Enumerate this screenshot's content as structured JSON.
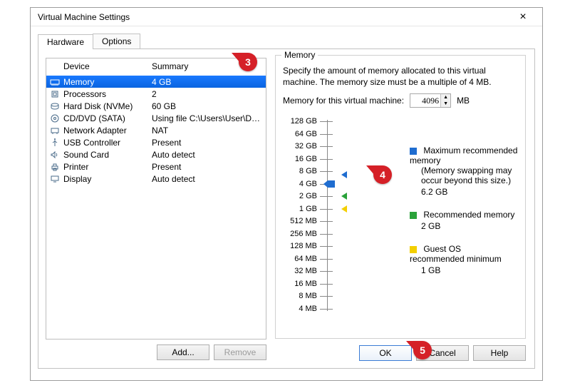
{
  "window": {
    "title": "Virtual Machine Settings"
  },
  "tabs": {
    "hardware": "Hardware",
    "options": "Options",
    "active": "hardware"
  },
  "device_list": {
    "headers": {
      "device": "Device",
      "summary": "Summary"
    },
    "rows": [
      {
        "id": "memory",
        "name": "Memory",
        "summary": "4 GB",
        "selected": true
      },
      {
        "id": "cpu",
        "name": "Processors",
        "summary": "2",
        "selected": false
      },
      {
        "id": "hdd",
        "name": "Hard Disk (NVMe)",
        "summary": "60 GB",
        "selected": false
      },
      {
        "id": "cddvd",
        "name": "CD/DVD (SATA)",
        "summary": "Using file C:\\Users\\User\\Do...",
        "selected": false
      },
      {
        "id": "net",
        "name": "Network Adapter",
        "summary": "NAT",
        "selected": false
      },
      {
        "id": "usb",
        "name": "USB Controller",
        "summary": "Present",
        "selected": false
      },
      {
        "id": "sound",
        "name": "Sound Card",
        "summary": "Auto detect",
        "selected": false
      },
      {
        "id": "printer",
        "name": "Printer",
        "summary": "Present",
        "selected": false
      },
      {
        "id": "display",
        "name": "Display",
        "summary": "Auto detect",
        "selected": false
      }
    ],
    "buttons": {
      "add": "Add...",
      "remove": "Remove"
    }
  },
  "memory_panel": {
    "group_title": "Memory",
    "description": "Specify the amount of memory allocated to this virtual machine. The memory size must be a multiple of 4 MB.",
    "field_label": "Memory for this virtual machine:",
    "value_mb": "4096",
    "unit": "MB",
    "scale": [
      {
        "label": "128 GB",
        "major": true
      },
      {
        "label": "64 GB",
        "major": true
      },
      {
        "label": "32 GB",
        "major": true
      },
      {
        "label": "16 GB",
        "major": true
      },
      {
        "label": "8 GB",
        "major": true
      },
      {
        "label": "4 GB",
        "major": true
      },
      {
        "label": "2 GB",
        "major": true
      },
      {
        "label": "1 GB",
        "major": true
      },
      {
        "label": "512 MB",
        "major": true
      },
      {
        "label": "256 MB",
        "major": true
      },
      {
        "label": "128 MB",
        "major": true
      },
      {
        "label": "64 MB",
        "major": true
      },
      {
        "label": "32 MB",
        "major": true
      },
      {
        "label": "16 MB",
        "major": true
      },
      {
        "label": "8 MB",
        "major": true
      },
      {
        "label": "4 MB",
        "major": true
      }
    ],
    "markers": {
      "slider_at_index": 5,
      "max_recommended_index": 4.3,
      "recommended_index": 6,
      "guest_min_index": 7
    },
    "legend": {
      "max": {
        "label": "Maximum recommended memory",
        "sub": "(Memory swapping may occur beyond this size.)",
        "value": "6.2 GB",
        "color": "#1f6dd0"
      },
      "rec": {
        "label": "Recommended memory",
        "sub": "",
        "value": "2 GB",
        "color": "#2aa23a"
      },
      "guest": {
        "label": "Guest OS recommended minimum",
        "sub": "",
        "value": "1 GB",
        "color": "#f3cf00"
      }
    }
  },
  "bottom_buttons": {
    "ok": "OK",
    "cancel": "Cancel",
    "help": "Help"
  },
  "callouts": {
    "c3": "3",
    "c4": "4",
    "c5": "5"
  }
}
